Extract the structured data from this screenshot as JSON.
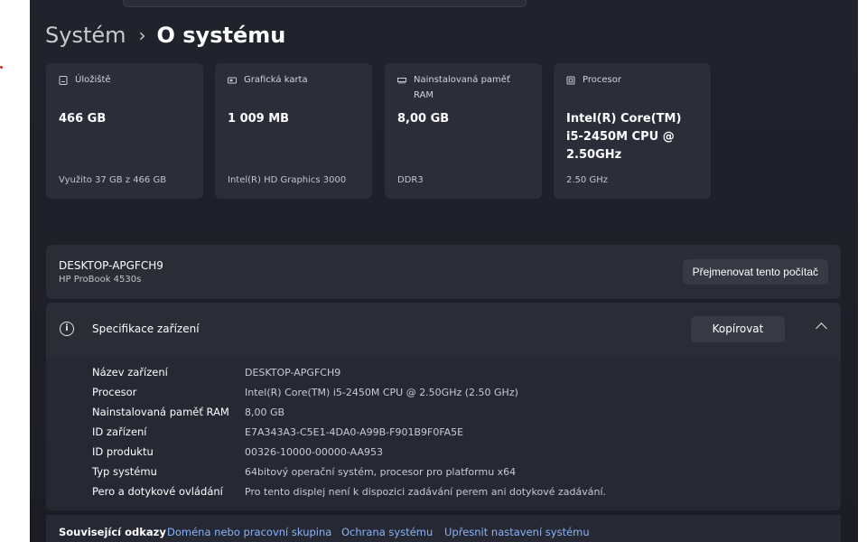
{
  "breadcrumb": {
    "parent": "Systém",
    "separator": "›",
    "current": "O systému"
  },
  "cards": [
    {
      "icon": "storage-icon",
      "label": "Úložiště",
      "value": "466 GB",
      "sub": "Využito 37 GB z 466 GB"
    },
    {
      "icon": "graphics-card-icon",
      "label": "Grafická karta",
      "value": "1 009 MB",
      "sub": "Intel(R) HD Graphics 3000"
    },
    {
      "icon": "memory-icon",
      "label": "Nainstalovaná paměť RAM",
      "value": "8,00 GB",
      "sub": "DDR3"
    },
    {
      "icon": "processor-icon",
      "label": "Procesor",
      "value": "Intel(R) Core(TM) i5-2450M CPU @ 2.50GHz",
      "sub": "2.50 GHz"
    }
  ],
  "device": {
    "name": "DESKTOP-APGFCH9",
    "model": "HP ProBook 4530s",
    "rename_label": "Přejmenovat tento počítač"
  },
  "spec": {
    "title": "Specifikace zařízení",
    "copy_label": "Kopírovat",
    "rows": [
      {
        "key": "Název zařízení",
        "value": "DESKTOP-APGFCH9"
      },
      {
        "key": "Procesor",
        "value": "Intel(R) Core(TM) i5-2450M CPU @ 2.50GHz (2.50 GHz)"
      },
      {
        "key": "Nainstalovaná paměť RAM",
        "value": "8,00 GB"
      },
      {
        "key": "ID zařízení",
        "value": "E7A343A3-C5E1-4DA0-A99B-F901B9F0FA5E"
      },
      {
        "key": "ID produktu",
        "value": "00326-10000-00000-AA953"
      },
      {
        "key": "Typ systému",
        "value": "64bitový operační systém, procesor pro platformu x64"
      },
      {
        "key": "Pero a dotykové ovládání",
        "value": "Pro tento displej není k dispozici zadávání perem ani dotykové zadávání."
      }
    ]
  },
  "related": {
    "title": "Související odkazy",
    "links": [
      "Doména nebo pracovní skupina",
      "Ochrana systému",
      "Upřesnit nastavení systému"
    ]
  },
  "colors": {
    "background": "#1e2029",
    "card": "#2b2d38",
    "link": "#8ab4f8"
  }
}
